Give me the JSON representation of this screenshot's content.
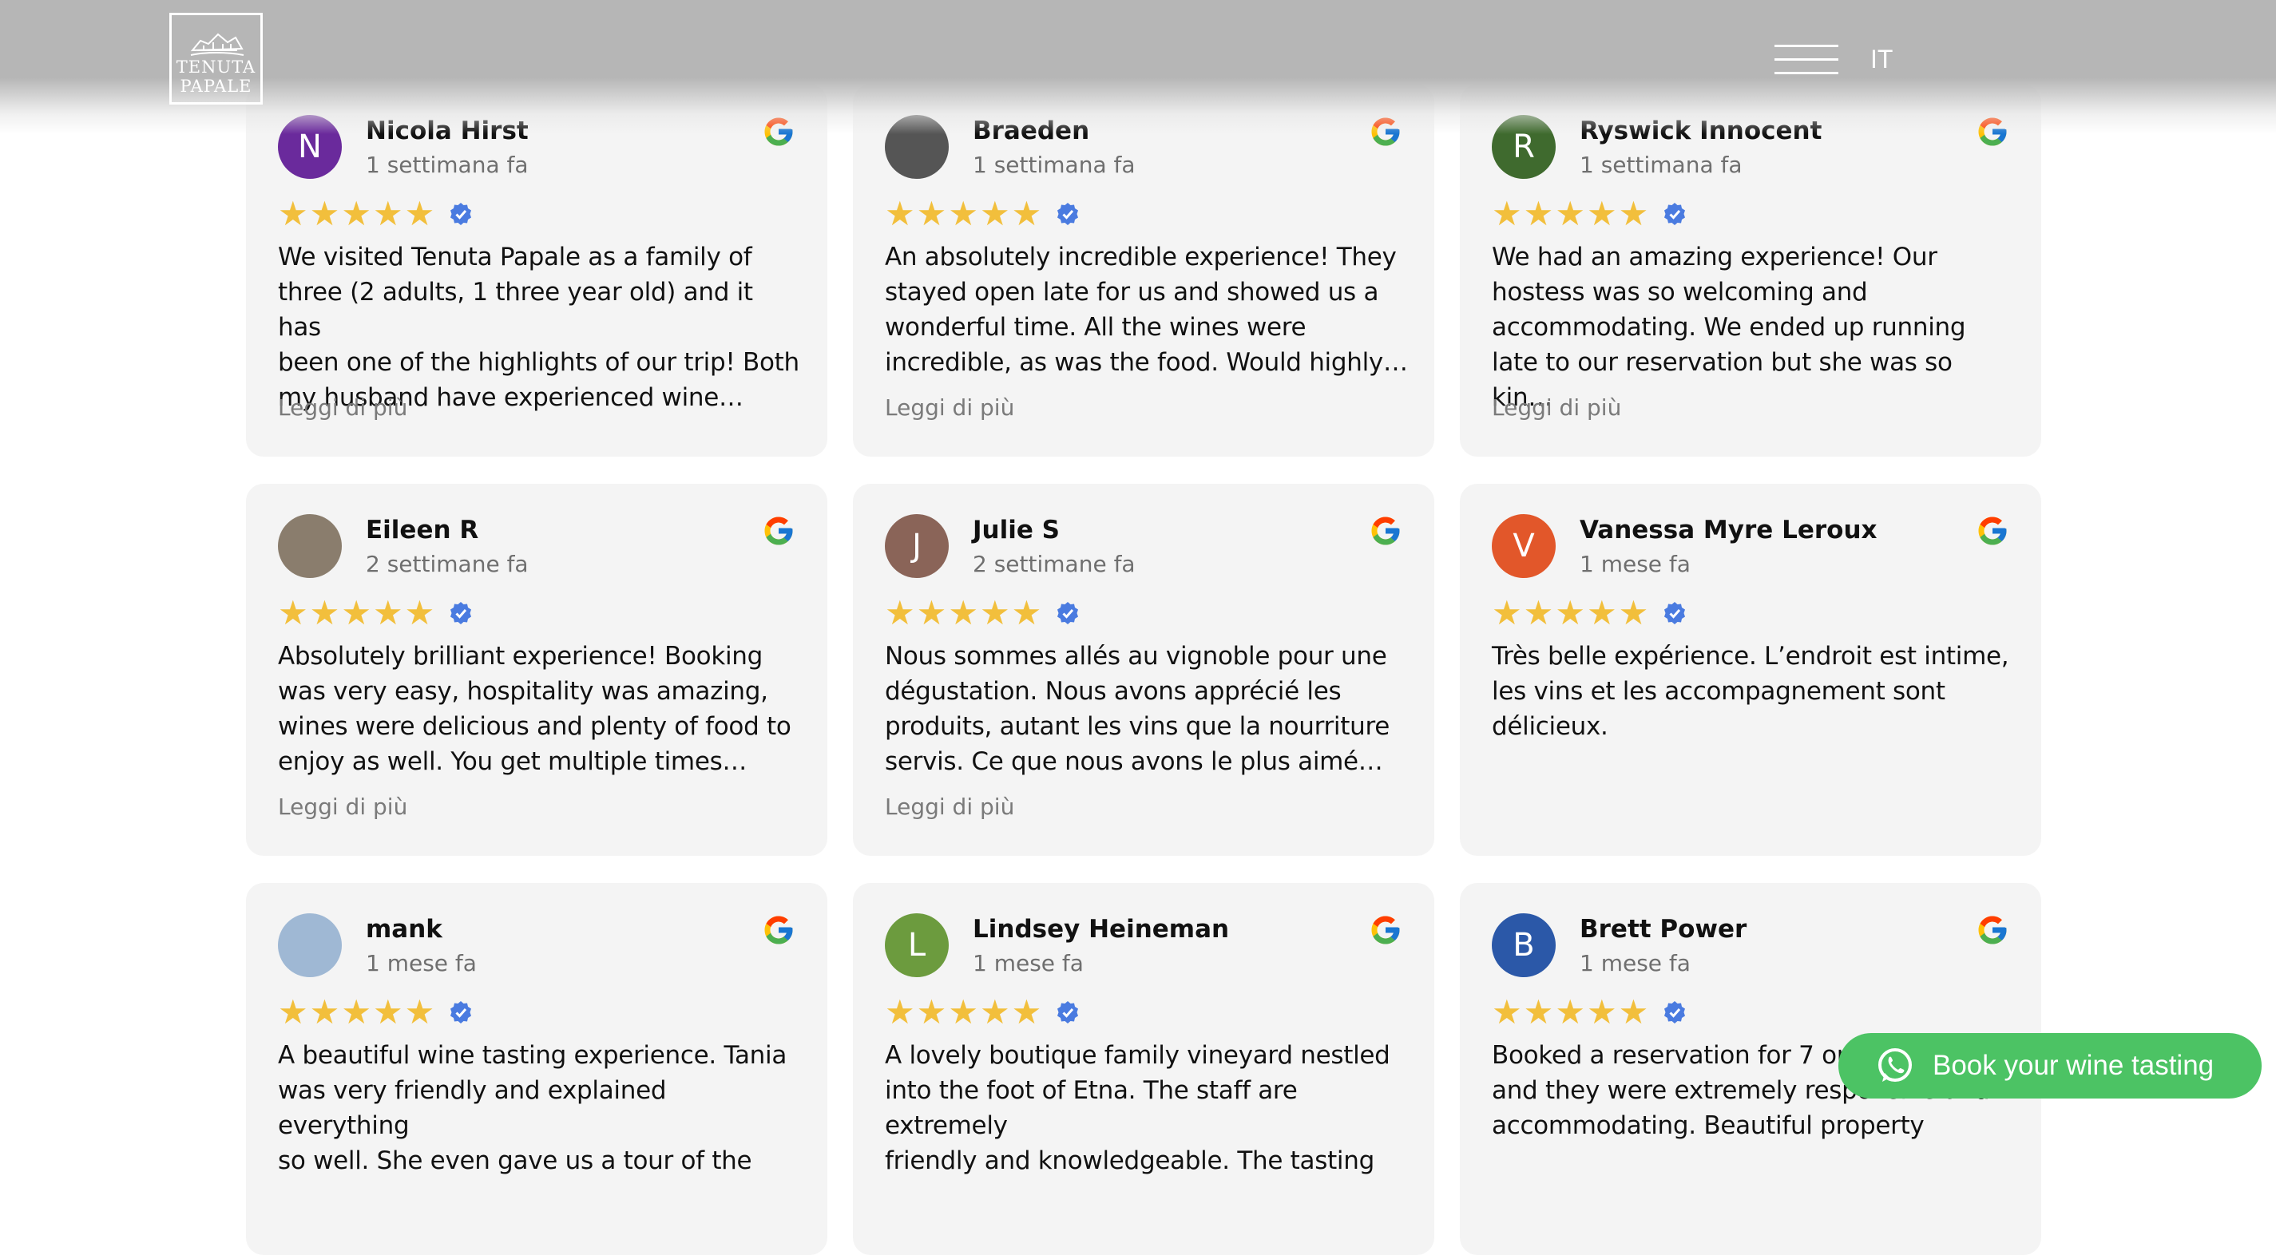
{
  "header": {
    "logo_line1": "TENUTA",
    "logo_line2": "PAPALE",
    "language": "IT"
  },
  "read_more_label": "Leggi di più",
  "reviews": [
    {
      "name": "Nicola Hirst",
      "time": "1 settimana fa",
      "initial": "N",
      "avatar_color": "#6a2a9c",
      "stars": 5,
      "lines": [
        "We visited Tenuta Papale as a family of",
        "three (2 adults, 1 three year old) and it has",
        "been one of the highlights of our trip! Both",
        "my husband have experienced wine…"
      ],
      "read_more": true
    },
    {
      "name": "Braeden",
      "time": "1 settimana fa",
      "initial": "",
      "avatar_color": "#555555",
      "stars": 5,
      "lines": [
        "An absolutely incredible experience! They",
        "stayed open late for us and showed us a",
        "wonderful time. All the wines were",
        "incredible, as was the food. Would highly…"
      ],
      "read_more": true
    },
    {
      "name": "Ryswick Innocent",
      "time": "1 settimana fa",
      "initial": "R",
      "avatar_color": "#3f6a2e",
      "stars": 5,
      "lines": [
        "We had an amazing experience! Our",
        "hostess was so welcoming and",
        "accommodating. We ended up running",
        "late to our reservation but she was so kin…"
      ],
      "read_more": true
    },
    {
      "name": "Eileen R",
      "time": "2 settimane fa",
      "initial": "",
      "avatar_color": "#8a7d6d",
      "stars": 5,
      "lines": [
        "Absolutely brilliant experience! Booking",
        "was very easy, hospitality was amazing,",
        "wines were delicious and plenty of food to",
        "enjoy as well. You get multiple times…"
      ],
      "read_more": true
    },
    {
      "name": "Julie S",
      "time": "2 settimane fa",
      "initial": "J",
      "avatar_color": "#8a6458",
      "stars": 5,
      "lines": [
        "Nous sommes allés au vignoble pour une",
        "dégustation. Nous avons apprécié les",
        "produits, autant les vins que la nourriture",
        "servis. Ce que nous avons le plus aimé…"
      ],
      "read_more": true
    },
    {
      "name": "Vanessa Myre Leroux",
      "time": "1 mese fa",
      "initial": "V",
      "avatar_color": "#e2572a",
      "stars": 5,
      "lines": [
        "Très belle expérience. L’endroit est intime,",
        "les vins et les accompagnement sont",
        "délicieux."
      ],
      "read_more": false
    },
    {
      "name": "mank",
      "time": "1 mese fa",
      "initial": "",
      "avatar_color": "#9fb8d4",
      "stars": 5,
      "lines": [
        "A beautiful wine tasting experience. Tania",
        "was very friendly and explained everything",
        "so well. She even gave us a tour of the"
      ],
      "read_more": false
    },
    {
      "name": "Lindsey Heineman",
      "time": "1 mese fa",
      "initial": "L",
      "avatar_color": "#6c9b3e",
      "stars": 5,
      "lines": [
        "A lovely boutique family vineyard nestled",
        "into the foot of Etna. The staff are extremely",
        "friendly and knowledgeable. The tasting"
      ],
      "read_more": false
    },
    {
      "name": "Brett Power",
      "time": "1 mese fa",
      "initial": "B",
      "avatar_color": "#2b58a8",
      "stars": 5,
      "lines": [
        "Booked a reservation for 7 on",
        "and they were extremely responsive and",
        "accommodating. Beautiful property"
      ],
      "read_more": false
    }
  ],
  "whatsapp_button": {
    "label": "Book your wine tasting"
  },
  "colors": {
    "star": "#f2bf3c",
    "verified": "#4a7be0",
    "whatsapp": "#4cc364"
  }
}
